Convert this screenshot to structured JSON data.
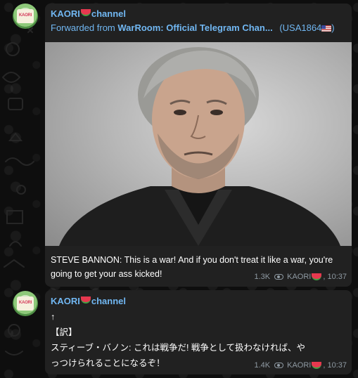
{
  "messages": [
    {
      "sender": "KAORI",
      "sender_suffix": "channel",
      "avatar_text": "KAORI",
      "forward_prefix": "Forwarded from",
      "forward_source": "WarRoom: Official Telegram Chan...",
      "forward_tag": "(USA1864",
      "forward_tag_end": ")",
      "text": "STEVE BANNON: This is a war! And if you don't treat it like a war, you're going to get your ass kicked!",
      "views": "1.3K",
      "author": "KAORI",
      "time": "10:37"
    },
    {
      "sender": "KAORI",
      "sender_suffix": "channel",
      "avatar_text": "KAORI",
      "text_line1": "↑",
      "text_line2": "【訳】",
      "text_line3": "スティーブ・バノン: これは戦争だ! 戦争として扱わなければ、や",
      "text_line4": "っつけられることになるぞ！",
      "views": "1.4K",
      "author": "KAORI",
      "time": "10:37"
    }
  ],
  "colors": {
    "background": "#0e0e0e",
    "bubble": "#212121",
    "accent": "#71b7f2",
    "meta": "#8f9aa3"
  },
  "icons": [
    "watermelon-emoji",
    "us-flag-emoji",
    "eye-icon"
  ]
}
